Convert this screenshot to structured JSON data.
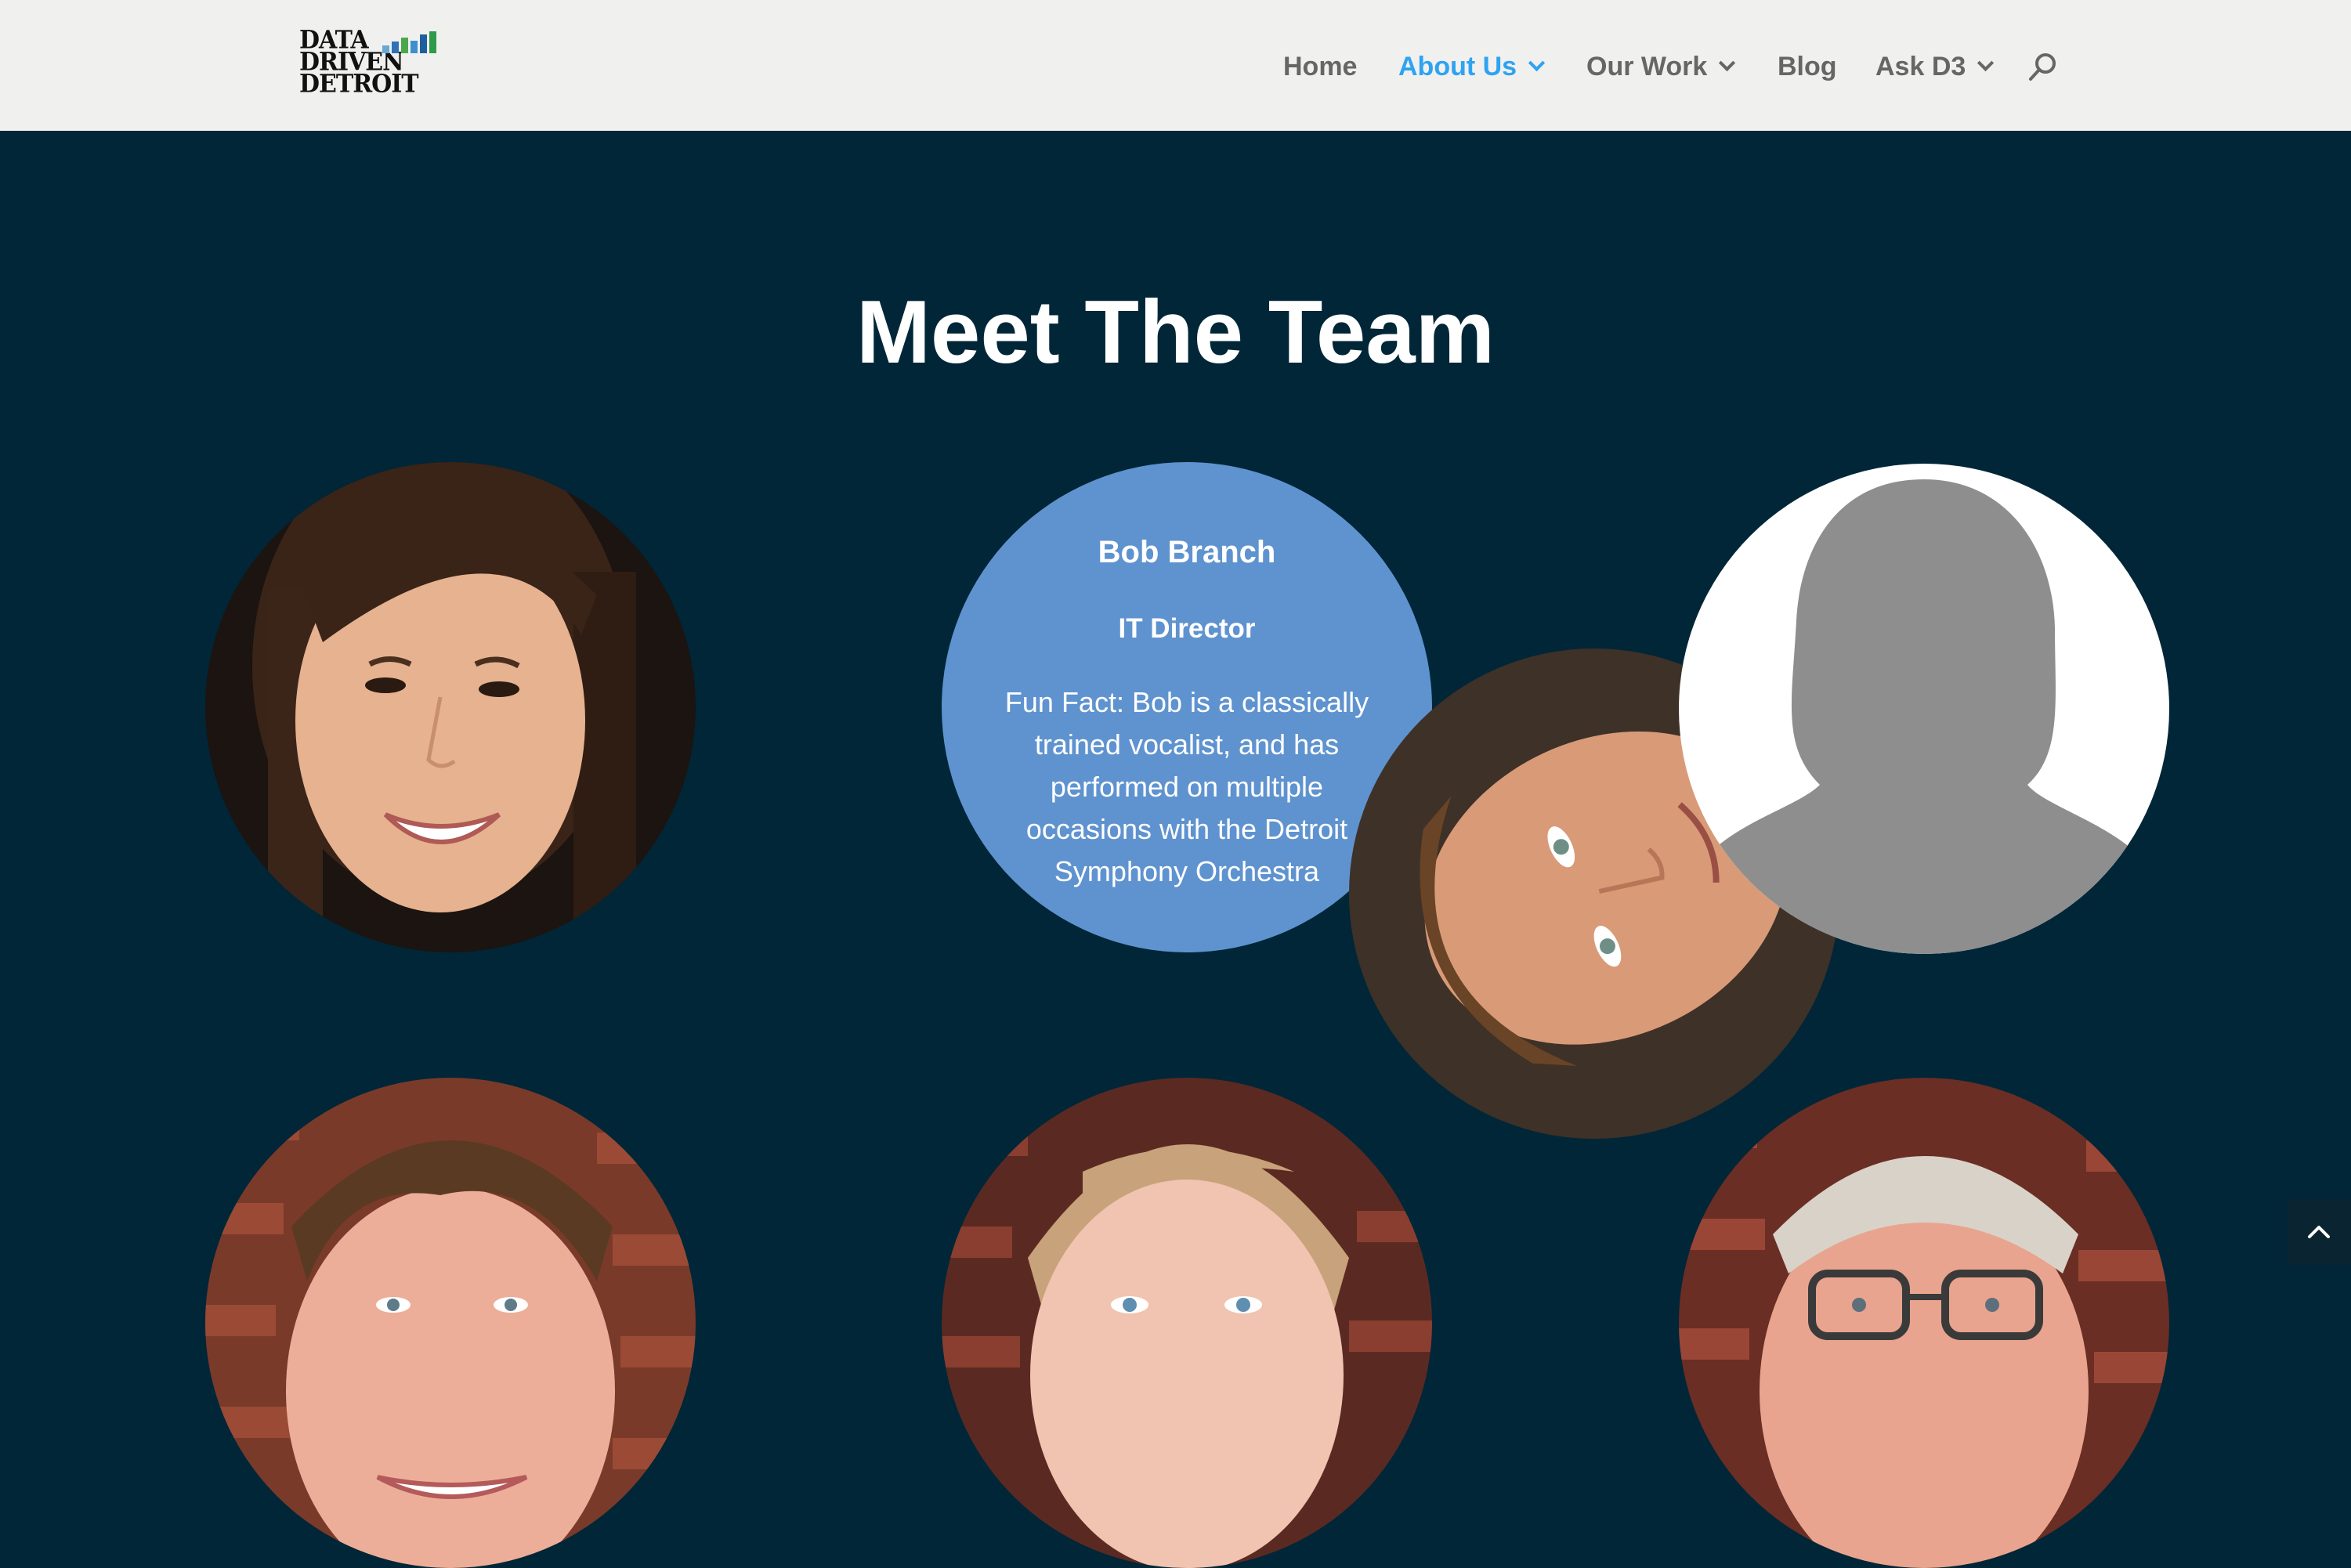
{
  "header": {
    "logo": {
      "lines": [
        "DATA",
        "DRIVEN",
        "DETROIT"
      ],
      "bar_colors": [
        "#66a8d8",
        "#2e73b8",
        "#4aa84a",
        "#3f8fcf",
        "#1f5f9f",
        "#2f9a4a"
      ]
    },
    "nav": [
      {
        "label": "Home",
        "has_dropdown": false,
        "active": false
      },
      {
        "label": "About Us",
        "has_dropdown": true,
        "active": true
      },
      {
        "label": "Our Work",
        "has_dropdown": true,
        "active": false
      },
      {
        "label": "Blog",
        "has_dropdown": false,
        "active": false
      },
      {
        "label": "Ask D3",
        "has_dropdown": true,
        "active": false
      }
    ],
    "search_icon": "search-icon"
  },
  "main": {
    "title": "Meet The Team",
    "featured": {
      "name": "Bob Branch",
      "role": "IT Director",
      "fun_fact": "Fun Fact: Bob is a classically trained vocalist, and has performed on multiple occasions with the Detroit Symphony Orchestra"
    }
  },
  "colors": {
    "background": "#002638",
    "header_bg": "#f0f0ef",
    "accent": "#2ea3f2",
    "nav_text": "#666666",
    "card_blue": "#5f93cf"
  },
  "back_to_top_icon": "chevron-up-icon"
}
